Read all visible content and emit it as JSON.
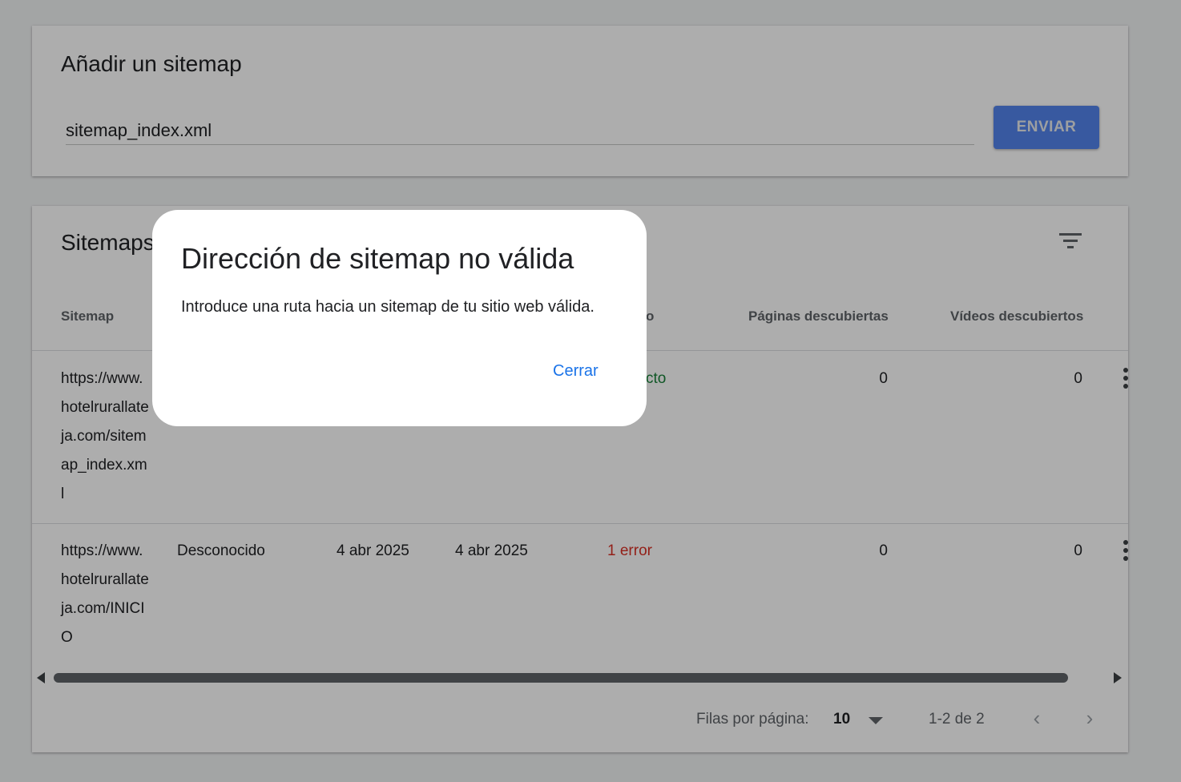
{
  "add_sitemap": {
    "title": "Añadir un sitemap",
    "input_value": "sitemap_index.xml",
    "submit_label": "ENVIAR"
  },
  "sitemaps": {
    "title": "Sitemaps",
    "filter_icon": "filter-list-icon",
    "columns": {
      "sitemap": "Sitemap",
      "status_fragment": "o",
      "pages": "Páginas descubiertas",
      "videos": "Vídeos descubiertos"
    },
    "rows": [
      {
        "url": "https://www.hotelrurallateja.com/sitemap_index.xml",
        "status": "cto",
        "pages": "0",
        "videos": "0"
      },
      {
        "url": "https://www.hotelrurallateja.com/INICIO",
        "type": "Desconocido",
        "submitted": "4 abr 2025",
        "last_read": "4 abr 2025",
        "status": "1 error",
        "pages": "0",
        "videos": "0"
      }
    ],
    "pagination": {
      "rows_per_page_label": "Filas por página:",
      "rows_per_page_value": "10",
      "range": "1-2 de 2",
      "prev": "‹",
      "next": "›"
    }
  },
  "dialog": {
    "title": "Dirección de sitemap no válida",
    "body": "Introduce una ruta hacia un sitemap de tu sitio web válida.",
    "close_label": "Cerrar"
  },
  "colors": {
    "accent": "#5383ec",
    "link": "#1a73e8",
    "success": "#188038",
    "error": "#d93025"
  }
}
